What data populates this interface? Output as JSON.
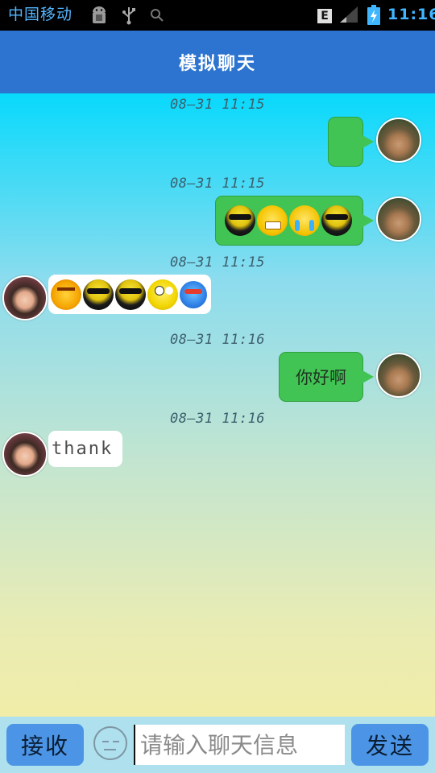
{
  "status_bar": {
    "carrier": "中国移动",
    "network_type": "E",
    "time": "11:16",
    "icons": [
      "android-debug-icon",
      "usb-icon",
      "search-icon",
      "signal-icon",
      "battery-charging-icon"
    ]
  },
  "header": {
    "title": "模拟聊天"
  },
  "messages": [
    {
      "time": "08—31 11:15",
      "direction": "out",
      "text": "",
      "emojis": []
    },
    {
      "time": "08—31 11:15",
      "direction": "out",
      "text": "",
      "emojis": [
        "cool",
        "grimace",
        "cry",
        "cool"
      ]
    },
    {
      "time": "08—31 11:15",
      "direction": "in",
      "text": "",
      "emojis": [
        "angry",
        "cool",
        "cool",
        "drool",
        "blue"
      ]
    },
    {
      "time": "08—31 11:16",
      "direction": "out",
      "text": "你好啊",
      "emojis": []
    },
    {
      "time": "08—31 11:16",
      "direction": "in",
      "text": "thank",
      "emojis": []
    }
  ],
  "input_bar": {
    "receive_label": "接收",
    "send_label": "发送",
    "placeholder": "请输入聊天信息"
  },
  "colors": {
    "status_bar": "#000000",
    "accent_text": "#3fb6ff",
    "header": "#2c74cf",
    "bubble_out": "#42c454",
    "bubble_in": "#ffffff",
    "button": "#4c95e6",
    "input_bar": "#aee0ee"
  }
}
